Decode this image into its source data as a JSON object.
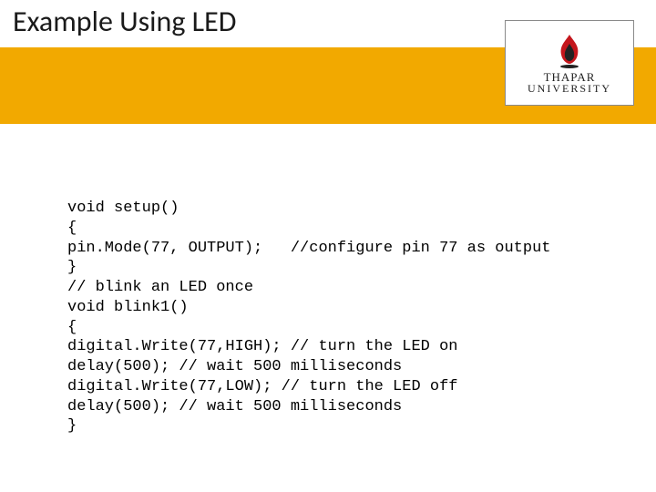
{
  "title": "Example Using LED",
  "logo": {
    "line1": "THAPAR",
    "line2": "UNIVERSITY"
  },
  "code": {
    "l1": "void setup()",
    "l2": "{",
    "l3": "pin.Mode(77, OUTPUT);   //configure pin 77 as output",
    "l4": "}",
    "l5": "// blink an LED once",
    "l6": "void blink1()",
    "l7": "{",
    "l8": "digital.Write(77,HIGH); // turn the LED on",
    "l9": "delay(500); // wait 500 milliseconds",
    "l10": "digital.Write(77,LOW); // turn the LED off",
    "l11": "delay(500); // wait 500 milliseconds",
    "l12": "}"
  }
}
